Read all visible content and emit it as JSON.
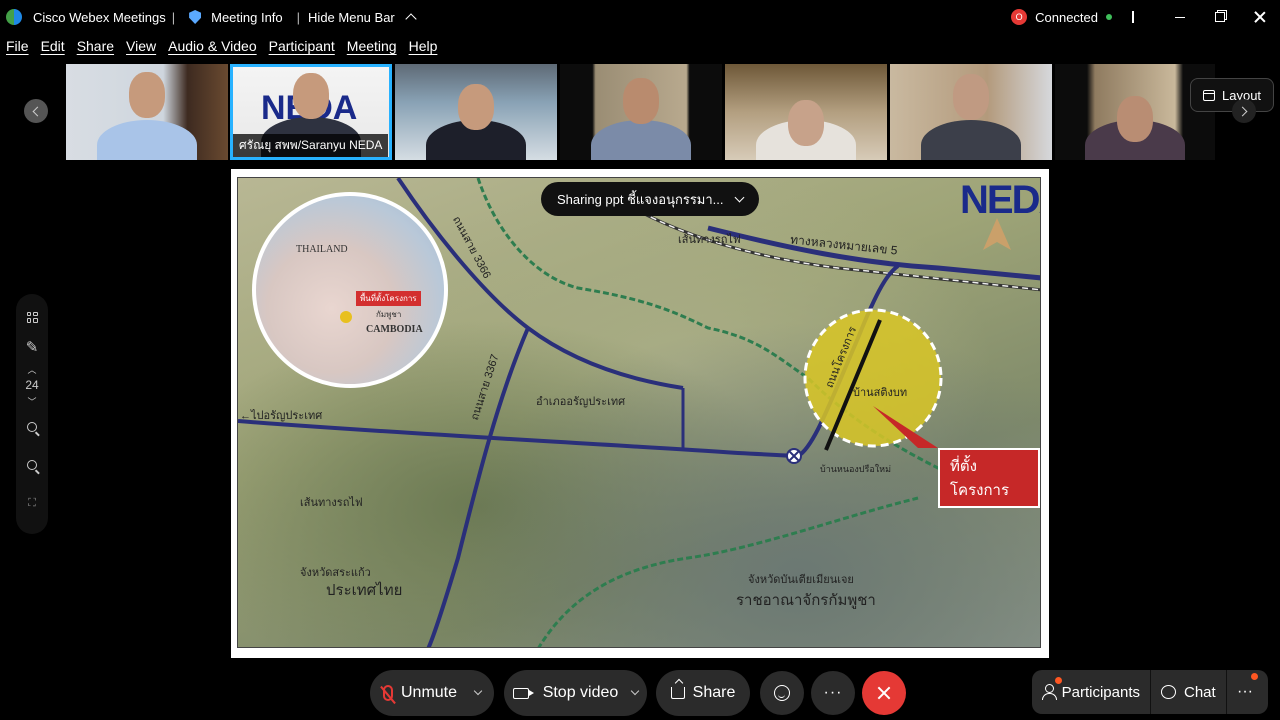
{
  "titlebar": {
    "app_name": "Cisco Webex Meetings",
    "meeting_info": "Meeting Info",
    "hide_menu_bar": "Hide Menu Bar",
    "recording_badge": "O",
    "connection_status": "Connected"
  },
  "menu": [
    "File",
    "Edit",
    "Share",
    "View",
    "Audio & Video",
    "Participant",
    "Meeting",
    "Help"
  ],
  "participants_strip": {
    "active_label": "ศรัณยุ สพพ/Saranyu NEDA",
    "layout_label": "Layout"
  },
  "side_tools": {
    "zoom_level": "24"
  },
  "share": {
    "banner": "Sharing ppt ชี้แจงอนุกรรมา...",
    "map_labels": {
      "thailand": "THAILAND",
      "cambodia": "CAMBODIA",
      "inset_site": "พื้นที่ตั้งโครงการ",
      "inset_kh": "กัมพูชา",
      "railway_top": "เส้นทางรถไฟ",
      "highway5": "ทางหลวงหมายเลข 5",
      "road_3366": "ถนนสาย 3366",
      "road_3367": "ถนนสาย 3367",
      "district": "อำเภออรัญประเทศ",
      "to_aranya": "←ไปอรัญประเทศ",
      "project_road": "ถนนโครงการ",
      "village1": "บ้านสติงบท",
      "village2": "บ้านหนองปรือใหม่",
      "railway_bottom": "เส้นทางรถไฟ",
      "sa_kaeo": "จังหวัดสระแก้ว",
      "thailand_th": "ประเทศไทย",
      "banteay": "จังหวัดบันเตียเมียนเจย",
      "cambodia_th": "ราชอาณาจักรกัมพูชา",
      "project_site": "ที่ตั้งโครงการ",
      "logo": "NEDA"
    }
  },
  "controls": {
    "unmute": "Unmute",
    "stop_video": "Stop video",
    "share": "Share",
    "more": "···",
    "participants": "Participants",
    "chat": "Chat",
    "more_right": "···"
  },
  "colors": {
    "accent": "#28b2ff",
    "end_call": "#e53935",
    "connected": "#3fbf5a",
    "road": "#2a2f7a"
  }
}
